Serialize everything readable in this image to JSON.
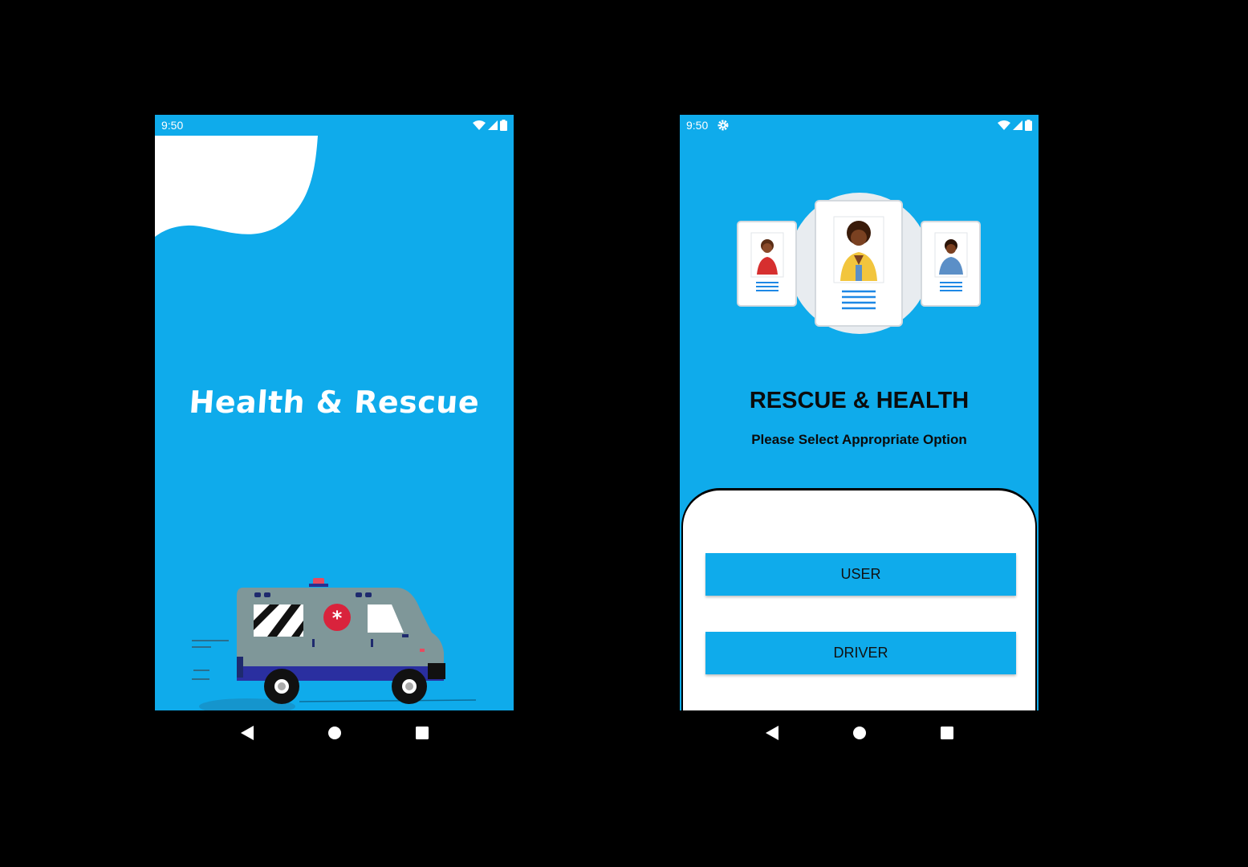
{
  "colors": {
    "primary": "#0fabeb",
    "background": "#000000",
    "surface": "#ffffff"
  },
  "left_phone": {
    "status_bar": {
      "time": "9:50",
      "icons": [
        "wifi-icon",
        "signal-icon",
        "battery-icon"
      ]
    },
    "splash": {
      "title": "Health & Rescue",
      "illustration": "ambulance-illustration"
    },
    "nav_bar": {
      "buttons": [
        "back-icon",
        "home-icon",
        "recents-icon"
      ]
    }
  },
  "right_phone": {
    "status_bar": {
      "time": "9:50",
      "icons": [
        "settings-icon",
        "wifi-icon",
        "signal-icon",
        "battery-icon"
      ]
    },
    "header": {
      "title": "RESCUE & HEALTH",
      "subtitle": "Please Select Appropriate Option",
      "illustration": "profile-cards-illustration"
    },
    "options": {
      "user_label": "USER",
      "driver_label": "DRIVER"
    },
    "nav_bar": {
      "buttons": [
        "back-icon",
        "home-icon",
        "recents-icon"
      ]
    }
  }
}
